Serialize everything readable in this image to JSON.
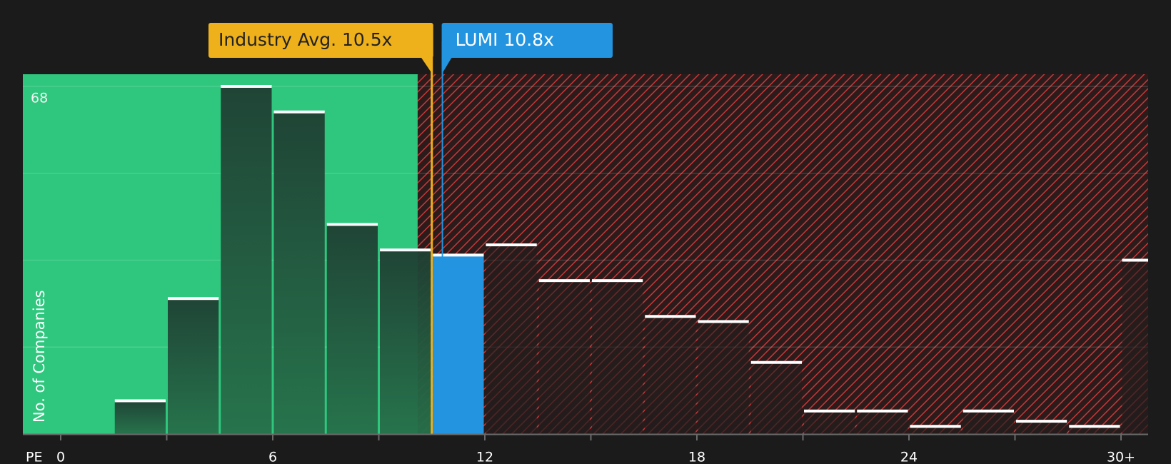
{
  "chart_data": {
    "type": "bar",
    "x_axis_label": "PE",
    "y_axis_label": "No. of Companies",
    "y_max_label": "68",
    "ylim": [
      0,
      68
    ],
    "x_ticks": [
      {
        "value": 0,
        "label": "0"
      },
      {
        "value": 6,
        "label": "6"
      },
      {
        "value": 12,
        "label": "12"
      },
      {
        "value": 18,
        "label": "18"
      },
      {
        "value": 24,
        "label": "24"
      },
      {
        "value": 30,
        "label": "30+"
      }
    ],
    "bin_width": 1.5,
    "bars": [
      {
        "start": 1.5,
        "value": 6.5
      },
      {
        "start": 3.0,
        "value": 26.5
      },
      {
        "start": 4.5,
        "value": 68
      },
      {
        "start": 6.0,
        "value": 63
      },
      {
        "start": 7.5,
        "value": 41
      },
      {
        "start": 9.0,
        "value": 36
      },
      {
        "start": 10.5,
        "value": 35,
        "highlight": true
      },
      {
        "start": 12.0,
        "value": 37
      },
      {
        "start": 13.5,
        "value": 30
      },
      {
        "start": 15.0,
        "value": 30
      },
      {
        "start": 16.5,
        "value": 23
      },
      {
        "start": 18.0,
        "value": 22
      },
      {
        "start": 19.5,
        "value": 14
      },
      {
        "start": 21.0,
        "value": 4.5
      },
      {
        "start": 22.5,
        "value": 4.5
      },
      {
        "start": 24.0,
        "value": 1.5
      },
      {
        "start": 25.5,
        "value": 4.5
      },
      {
        "start": 27.0,
        "value": 2.5
      },
      {
        "start": 28.5,
        "value": 1.5
      },
      {
        "start": 30.0,
        "value": 34
      }
    ],
    "fair_zone_end": 10.1,
    "industry_avg": {
      "value": 10.5,
      "label": "Industry Avg. 10.5x"
    },
    "company": {
      "value": 10.8,
      "label": "LUMI 10.8x"
    },
    "colors": {
      "background": "#1b1b1b",
      "undervalued_zone": "#2ec77d",
      "overvalued_hatch": "#c8383a",
      "industry": "#eeb11c",
      "company": "#2394e0",
      "bar_top": "#ffffff"
    }
  }
}
